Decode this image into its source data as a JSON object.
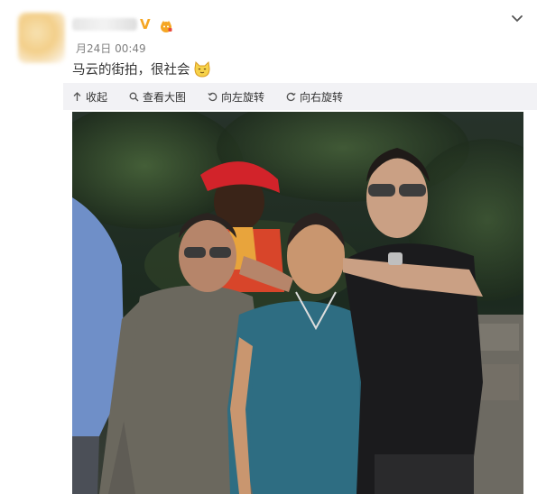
{
  "post": {
    "timestamp": "月24日 00:49",
    "text": "马云的街拍，很社会"
  },
  "author": {
    "verified_mark": "V",
    "avatar_icon": "avatar-image",
    "badge_icon": "cat-badge-icon"
  },
  "toolbar": {
    "collapse_label": "收起",
    "view_large_label": "查看大图",
    "rotate_left_label": "向左旋转",
    "rotate_right_label": "向右旋转"
  },
  "colors": {
    "toolbar_bg": "#f2f2f5",
    "accent_orange": "#f5a623",
    "timestamp_gray": "#808080"
  }
}
